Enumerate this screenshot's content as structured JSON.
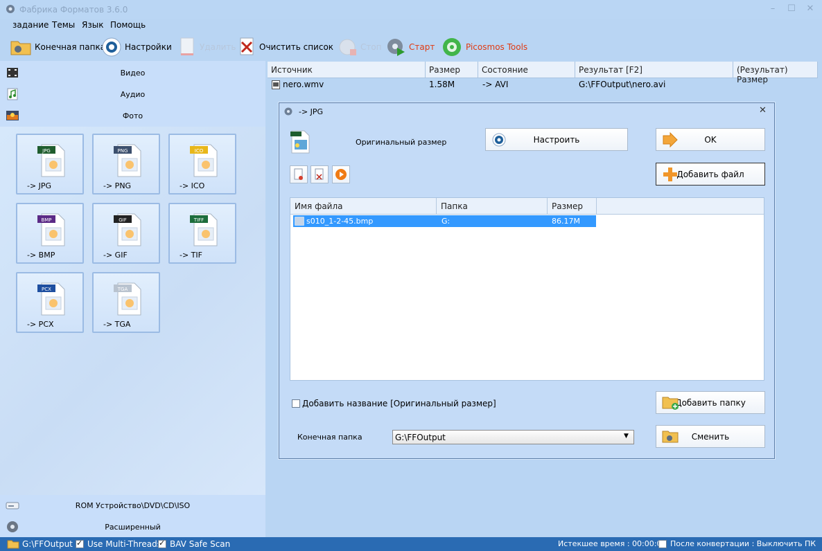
{
  "window": {
    "title": "Фабрика Форматов 3.6.0"
  },
  "menu": [
    "задание",
    "Темы",
    "Язык",
    "Помощь"
  ],
  "toolbar": {
    "output_folder": "Конечная папка",
    "settings": "Настройки",
    "delete": "Удалить",
    "clear_list": "Очистить список",
    "stop": "Стоп",
    "start": "Старт",
    "picosmos": "Picosmos Tools"
  },
  "categories": {
    "video": "Видео",
    "audio": "Аудио",
    "photo": "Фото",
    "rom": "ROM Устройство\\DVD\\CD\\ISO",
    "advanced": "Расширенный"
  },
  "formats": [
    {
      "tag": "JPG",
      "label": "-> JPG",
      "color": "#1f5d2e"
    },
    {
      "tag": "PNG",
      "label": "-> PNG",
      "color": "#3c4f6d"
    },
    {
      "tag": "ICO",
      "label": "-> ICO",
      "color": "#e8b71a"
    },
    {
      "tag": "BMP",
      "label": "-> BMP",
      "color": "#5b2a86"
    },
    {
      "tag": "GIF",
      "label": "-> GIF",
      "color": "#222222"
    },
    {
      "tag": "TIFF",
      "label": "-> TIF",
      "color": "#1d6d3c"
    },
    {
      "tag": "PCX",
      "label": "-> PCX",
      "color": "#1e4fa0"
    },
    {
      "tag": "TGA",
      "label": "-> TGA",
      "color": "#b9c3cf"
    }
  ],
  "filelist": {
    "columns": [
      "Источник",
      "Размер",
      "Состояние",
      "Результат [F2]",
      "(Результат) Размер"
    ],
    "rows": [
      {
        "source": "nero.wmv",
        "size": "1.58M",
        "state": "-> AVI",
        "result": "G:\\FFOutput\\nero.avi",
        "result_size": ""
      }
    ]
  },
  "dialog": {
    "title": "-> JPG",
    "original_size": "Оригинальный размер",
    "configure": "Настроить",
    "ok": "OK",
    "add_file": "Добавить файл",
    "columns": [
      "Имя файла",
      "Папка",
      "Размер"
    ],
    "files": [
      {
        "name": "s010_1-2-45.bmp",
        "folder": "G:",
        "size": "86.17M"
      }
    ],
    "add_name_checkbox": "Добавить название [Оригинальный размер]",
    "add_folder": "Добавить папку",
    "output_folder_label": "Конечная папка",
    "output_folder_value": "G:\\FFOutput",
    "change": "Сменить"
  },
  "statusbar": {
    "folder": "G:\\FFOutput",
    "multithreads": "Use Multi-Threads",
    "bav": "BAV Safe Scan",
    "elapsed": "Истекшее время : 00:00:00",
    "after": "После конвертации : Выключить ПК"
  }
}
